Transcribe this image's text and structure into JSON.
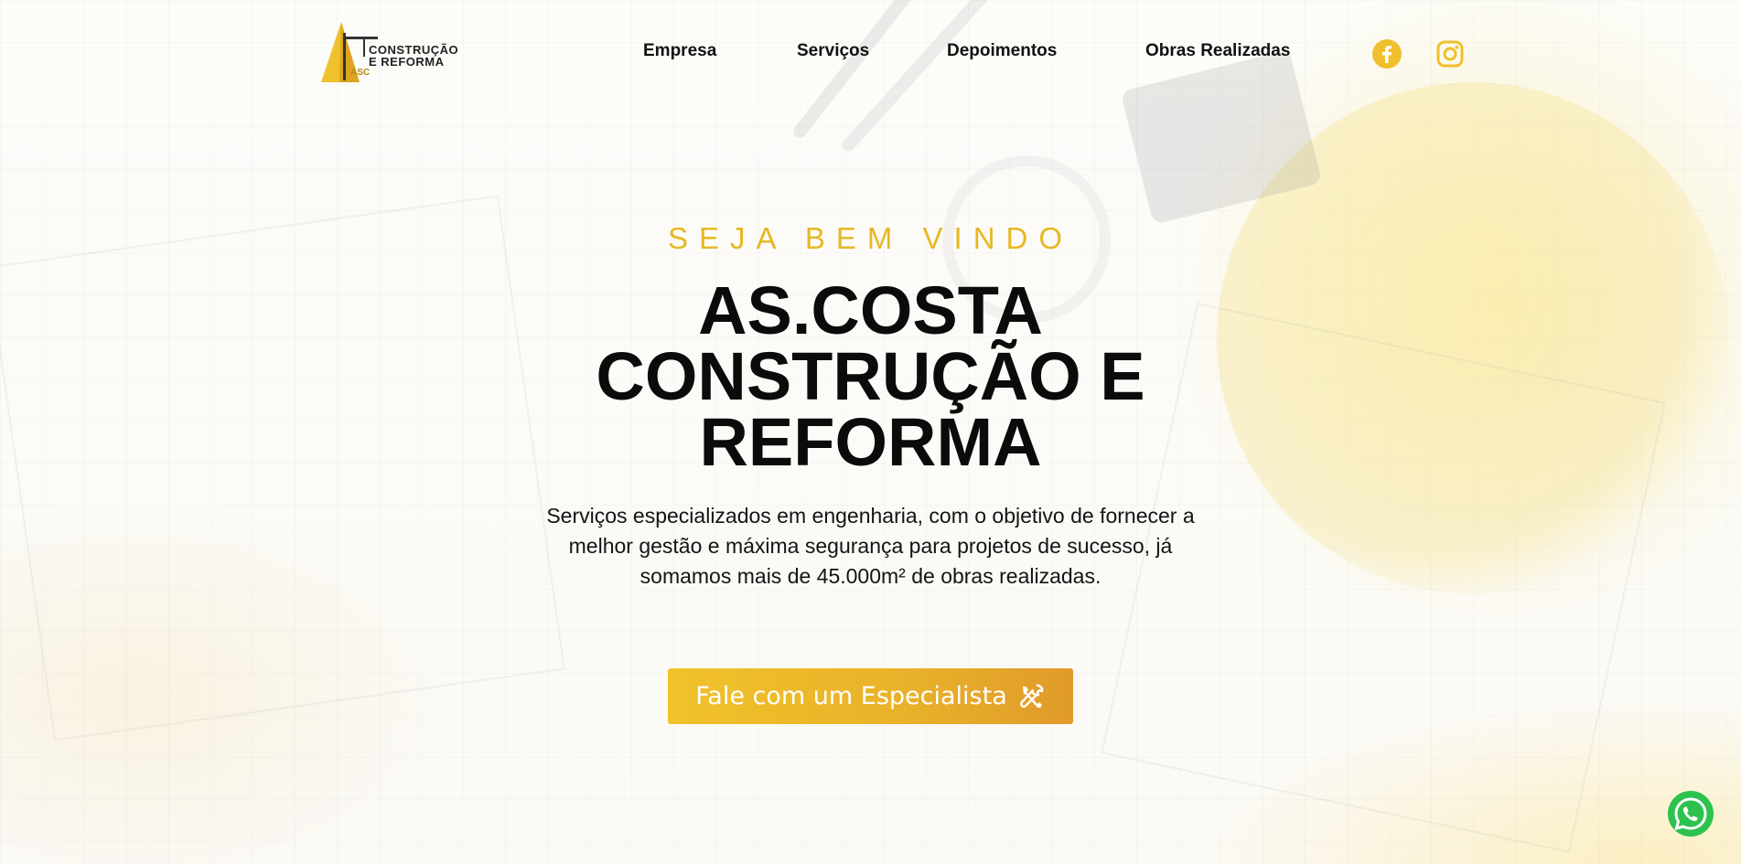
{
  "brand": {
    "logo_line1": "CONSTRUÇÃO",
    "logo_line2": "E REFORMA",
    "logo_mark": "ASC",
    "accent_color": "#EFBF2C"
  },
  "nav": {
    "items": [
      {
        "label": "Empresa"
      },
      {
        "label": "Serviços"
      },
      {
        "label": "Depoimentos"
      },
      {
        "label": "Obras Realizadas"
      }
    ],
    "social": [
      {
        "icon": "facebook-icon"
      },
      {
        "icon": "instagram-icon"
      }
    ]
  },
  "hero": {
    "eyebrow": "SEJA BEM VINDO",
    "title_lines": [
      "AS.COSTA",
      "CONSTRUÇÃO E",
      "REFORMA"
    ],
    "description": "Serviços especializados em engenharia, com o objetivo de fornecer a melhor gestão e máxima segurança para projetos de sucesso, já somamos mais de 45.000m² de obras realizadas.",
    "cta_label": "Fale com um Especialista",
    "cta_icon": "tools-icon"
  },
  "floating": {
    "whatsapp_icon": "whatsapp-icon"
  }
}
